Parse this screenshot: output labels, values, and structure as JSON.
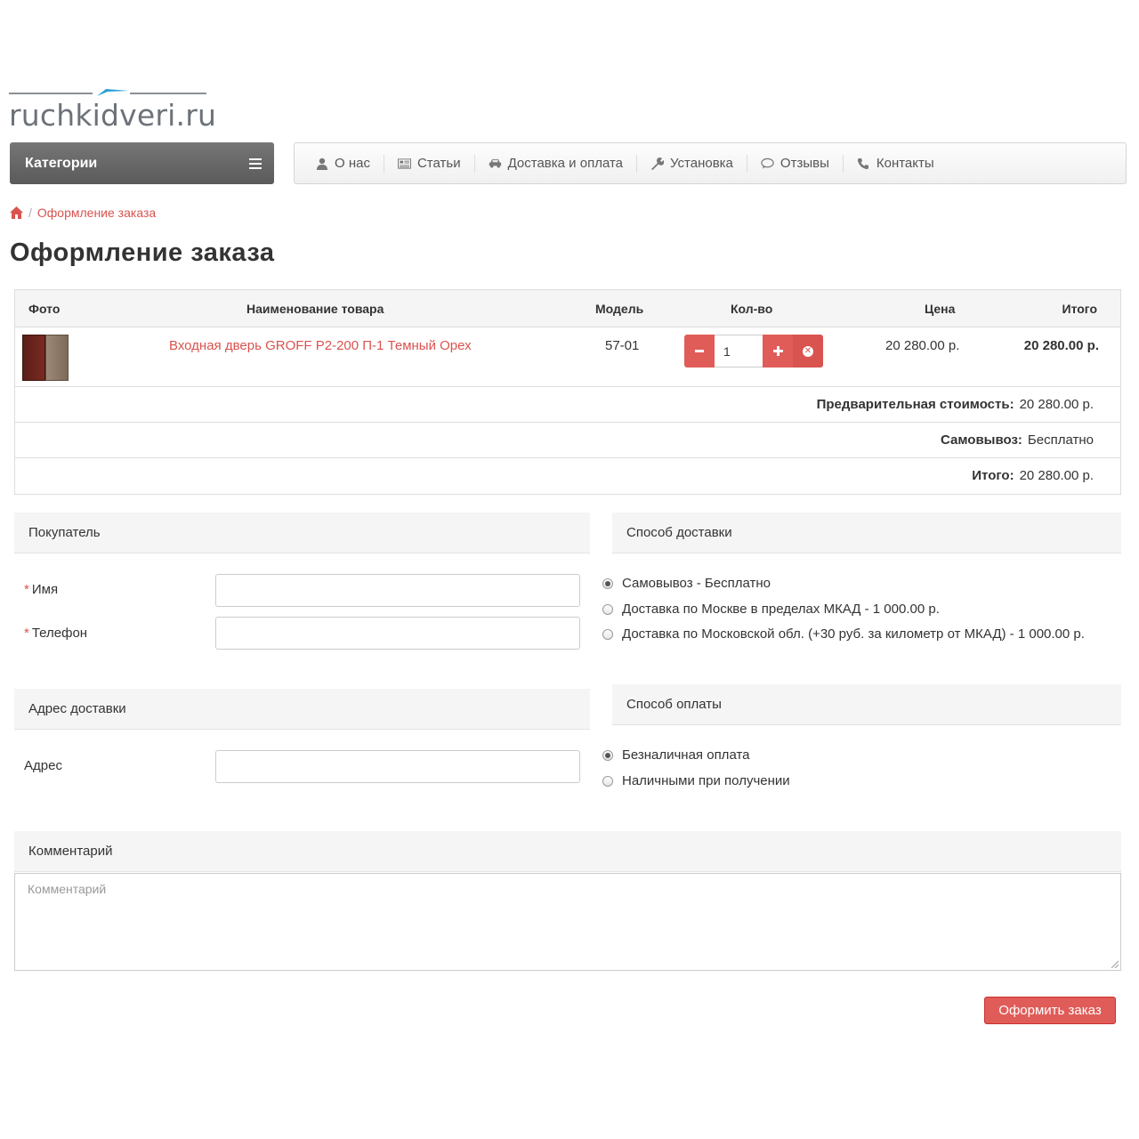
{
  "logo": {
    "text": "ruchkidveri.ru"
  },
  "categories": {
    "label": "Категории"
  },
  "nav": {
    "items": [
      {
        "label": "О нас",
        "icon": "user-icon"
      },
      {
        "label": "Статьи",
        "icon": "newspaper-icon"
      },
      {
        "label": "Доставка и оплата",
        "icon": "car-icon"
      },
      {
        "label": "Установка",
        "icon": "wrench-icon"
      },
      {
        "label": "Отзывы",
        "icon": "comment-icon"
      },
      {
        "label": "Контакты",
        "icon": "phone-icon"
      }
    ]
  },
  "breadcrumb": {
    "separator": "/",
    "current": "Оформление заказа"
  },
  "page": {
    "title": "Оформление заказа"
  },
  "cart": {
    "headers": {
      "photo": "Фото",
      "name": "Наименование товара",
      "model": "Модель",
      "qty": "Кол-во",
      "price": "Цена",
      "total": "Итого"
    },
    "items": [
      {
        "name": "Входная дверь GROFF P2-200 П-1 Темный Орех",
        "model": "57-01",
        "qty": "1",
        "price": "20 280.00 р.",
        "total": "20 280.00 р."
      }
    ],
    "summary": {
      "subtotal_label": "Предварительная стоимость:",
      "subtotal_value": "20 280.00 р.",
      "shipping_label": "Самовывоз:",
      "shipping_value": "Бесплатно",
      "total_label": "Итого:",
      "total_value": "20 280.00 р."
    }
  },
  "buyer": {
    "heading": "Покупатель",
    "name_label": "Имя",
    "phone_label": "Телефон",
    "required_mark": "*"
  },
  "delivery": {
    "heading": "Способ доставки",
    "options": [
      "Самовывоз - Бесплатно",
      "Доставка по Москве в пределах МКАД - 1 000.00 р.",
      "Доставка по Московской обл. (+30 руб. за километр от МКАД) - 1 000.00 р."
    ],
    "selected_index": 0
  },
  "address": {
    "heading": "Адрес доставки",
    "label": "Адрес"
  },
  "payment": {
    "heading": "Способ оплаты",
    "options": [
      "Безналичная оплата",
      "Наличными при получении"
    ],
    "selected_index": 0
  },
  "comment": {
    "heading": "Комментарий",
    "placeholder": "Комментарий"
  },
  "submit": {
    "label": "Оформить заказ"
  },
  "colors": {
    "accent": "#d9534f",
    "button": "#e05c58",
    "panel_bg": "#f5f5f5",
    "categories_bg": "#666666"
  }
}
